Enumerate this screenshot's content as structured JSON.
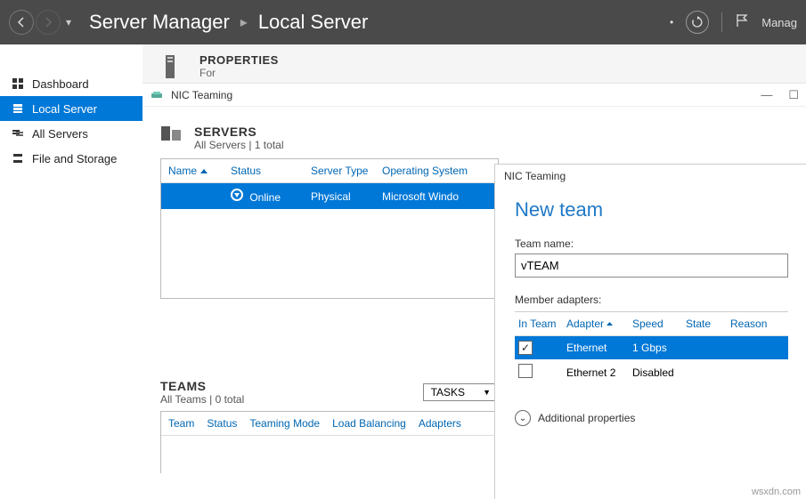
{
  "titlebar": {
    "breadcrumb1": "Server Manager",
    "breadcrumb2": "Local Server",
    "manage": "Manag"
  },
  "sidebar": {
    "items": [
      {
        "label": "Dashboard"
      },
      {
        "label": "Local Server"
      },
      {
        "label": "All Servers"
      },
      {
        "label": "File and Storage"
      }
    ]
  },
  "properties": {
    "title": "PROPERTIES",
    "for": "For"
  },
  "nic_window": {
    "title": "NIC Teaming"
  },
  "servers_section": {
    "title": "SERVERS",
    "sub": "All Servers | 1 total",
    "cols": {
      "name": "Name",
      "status": "Status",
      "type": "Server Type",
      "os": "Operating System"
    },
    "row": {
      "name": "",
      "status": "Online",
      "type": "Physical",
      "os": "Microsoft Windo"
    }
  },
  "teams_section": {
    "title": "TEAMS",
    "sub": "All Teams | 0 total",
    "tasks": "TASKS",
    "cols": {
      "team": "Team",
      "status": "Status",
      "mode": "Teaming Mode",
      "lb": "Load Balancing",
      "adapters": "Adapters"
    }
  },
  "newteam": {
    "titlebar": "NIC Teaming",
    "heading": "New team",
    "teamname_label": "Team name:",
    "teamname_value": "vTEAM",
    "members_label": "Member adapters:",
    "cols": {
      "inteam": "In Team",
      "adapter": "Adapter",
      "speed": "Speed",
      "state": "State",
      "reason": "Reason"
    },
    "rows": [
      {
        "checked": true,
        "adapter": "Ethernet",
        "speed": "1 Gbps",
        "state": "",
        "selected": true
      },
      {
        "checked": false,
        "adapter": "Ethernet 2",
        "speed": "Disabled",
        "state": "",
        "selected": false
      }
    ],
    "addl": "Additional properties"
  },
  "watermark": "wsxdn.com"
}
